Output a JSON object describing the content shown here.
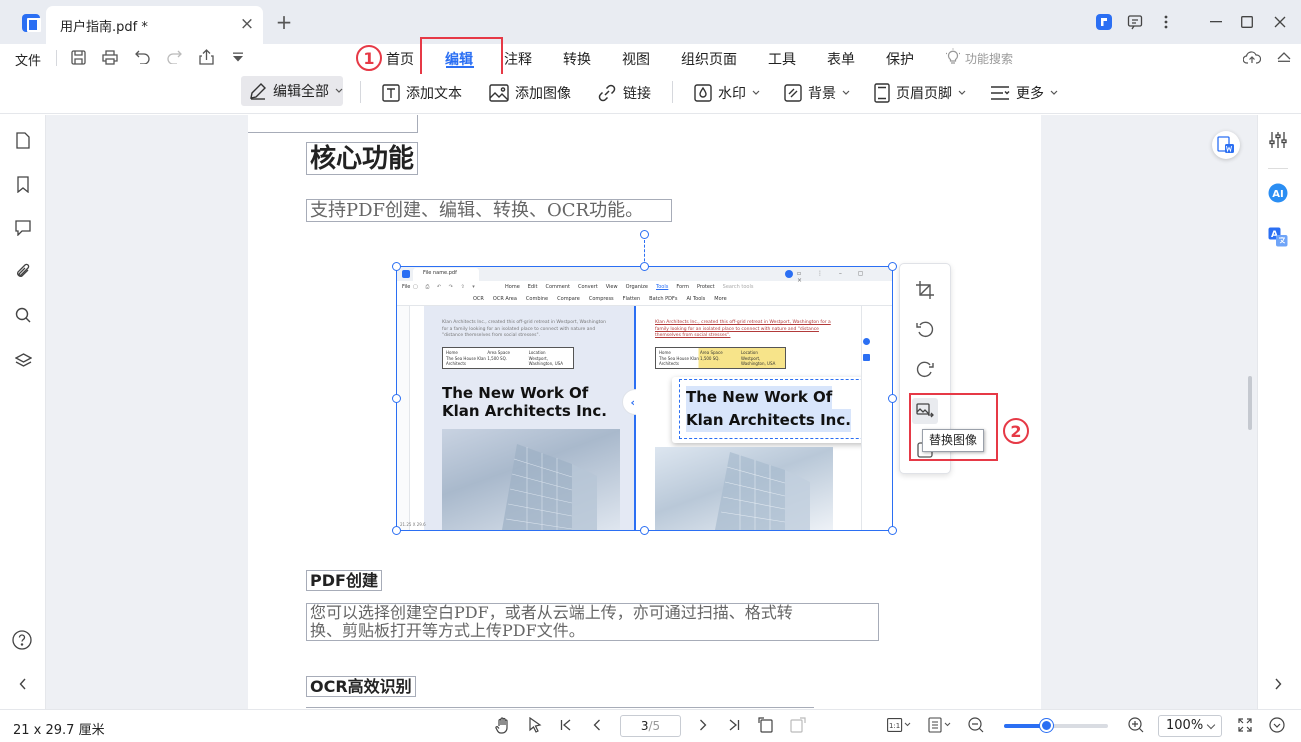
{
  "window": {
    "tab_title": "用户指南.pdf *",
    "tab_close": "×",
    "new_tab": "+"
  },
  "menubar": {
    "file": "文件",
    "tabs": [
      "首页",
      "编辑",
      "注释",
      "转换",
      "视图",
      "组织页面",
      "工具",
      "表单",
      "保护"
    ],
    "active_tab": "编辑",
    "feature_search": "功能搜索"
  },
  "markers": {
    "one": "1",
    "two": "2"
  },
  "toolbar": {
    "edit_all": "编辑全部",
    "add_text": "添加文本",
    "add_image": "添加图像",
    "link": "链接",
    "watermark": "水印",
    "background": "背景",
    "header_footer": "页眉页脚",
    "more": "更多"
  },
  "document": {
    "section_title": "核心功能",
    "section_subtitle": "支持PDF创建、编辑、转换、OCR功能。",
    "pdf_create_title": "PDF创建",
    "pdf_create_body_1": "您可以选择创建空白PDF，或者从云端上传，亦可通过扫描、格式转",
    "pdf_create_body_2": "换、剪贴板打开等方式上传PDF文件。",
    "ocr_title": "OCR高效识别"
  },
  "embedded_screenshot": {
    "tab": "File name.pdf",
    "menu": [
      "Home",
      "Edit",
      "Comment",
      "Convert",
      "View",
      "Organize",
      "Tools",
      "Form",
      "Protect"
    ],
    "search": "Search tools",
    "tools": [
      "OCR",
      "OCR Area",
      "Combine",
      "Compare",
      "Compress",
      "Flatten",
      "Batch PDFs",
      "AI Tools",
      "More"
    ],
    "para": "Klan Architects Inc., created this off-grid retreat in Westport, Washington for a family looking for an isolated place to connect with nature and \"distance themselves from social stresses\".",
    "table_headers": [
      "Home",
      "Area Space",
      "Location"
    ],
    "table_values": [
      "The Sea House Klan Architects",
      "1,500 SQ.",
      "Westport, Washington, USA"
    ],
    "heading_line1": "The New Work Of",
    "heading_line2": "Klan Architects Inc.",
    "page_status": "21.25 X 29.6"
  },
  "image_tools": {
    "tooltip": "替换图像"
  },
  "statusbar": {
    "page_size": "21 x 29.7 厘米",
    "page_current": "3",
    "page_total": "/5",
    "zoom": "100%",
    "zoom_level": 0.4
  },
  "colors": {
    "accent": "#2b6ff3",
    "annotation_red": "#e63946"
  }
}
